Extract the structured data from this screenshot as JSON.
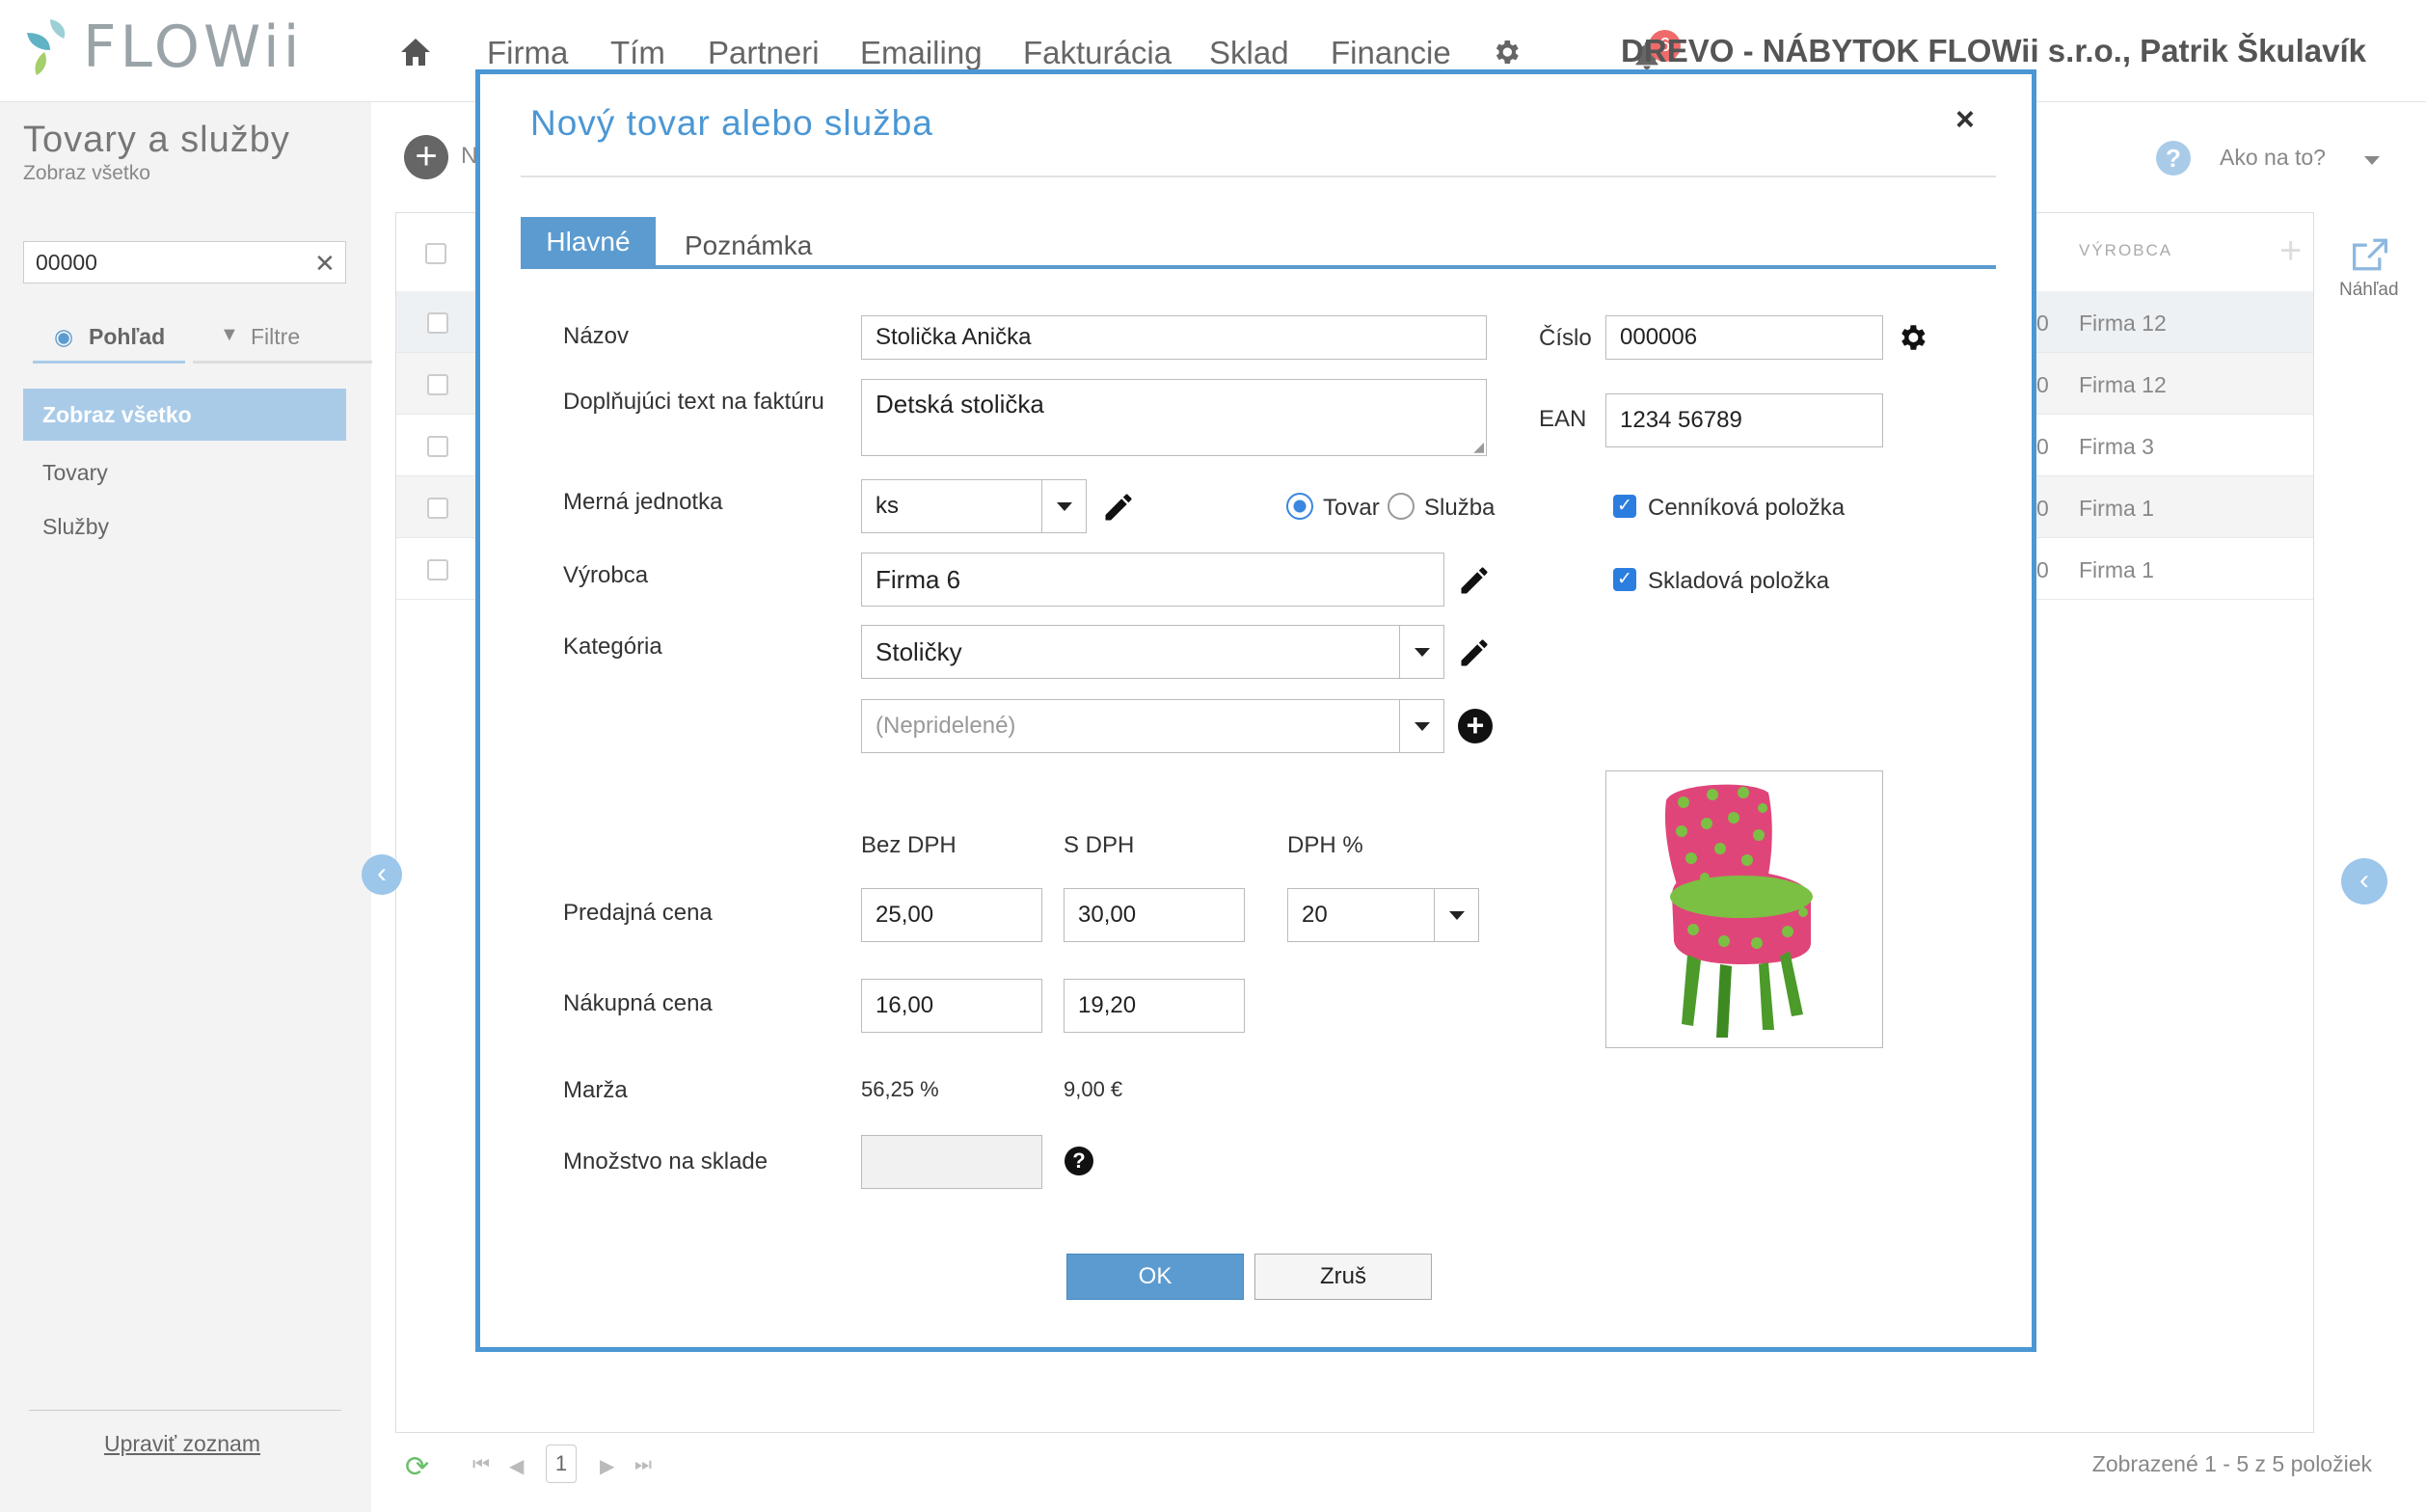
{
  "app": {
    "logo": "FLOWii",
    "nav": [
      "Firma",
      "Tím",
      "Partneri",
      "Emailing",
      "Fakturácia",
      "Sklad",
      "Financie"
    ],
    "notification_count": "6",
    "user": "DREVO - NÁBYTOK FLOWii s.r.o., Patrik Škulavík"
  },
  "page": {
    "title": "Tovary a služby",
    "subtitle": "Zobraz všetko",
    "new_label": "N",
    "help_label": "Ako na to?",
    "search_value": "00000",
    "tabs": [
      "Pohľad",
      "Filtre"
    ],
    "menu_active": "Zobraz všetko",
    "menu_items": [
      "Tovary",
      "Služby"
    ],
    "edit_list": "Upraviť zoznam",
    "column_vyrobca": "VÝROBCA",
    "preview_label": "Náhľad",
    "rows": [
      {
        "num": "0",
        "firma": "Firma 12"
      },
      {
        "num": "0",
        "firma": "Firma 12"
      },
      {
        "num": "0",
        "firma": "Firma 3"
      },
      {
        "num": "0",
        "firma": "Firma 1"
      },
      {
        "num": "0",
        "firma": "Firma 1"
      }
    ],
    "page_number": "1",
    "footer_info": "Zobrazené 1 - 5 z 5 položiek"
  },
  "modal": {
    "title": "Nový tovar alebo služba",
    "close": "×",
    "tabs": {
      "main": "Hlavné",
      "note": "Poznámka"
    },
    "labels": {
      "nazov": "Názov",
      "doplnujuci": "Doplňujúci text na faktúru",
      "merna": "Merná jednotka",
      "vyrobca": "Výrobca",
      "kategoria": "Kategória",
      "bez_dph": "Bez DPH",
      "s_dph": "S DPH",
      "dph_pct": "DPH %",
      "predajna": "Predajná cena",
      "nakupna": "Nákupná cena",
      "marza": "Marža",
      "mnozstvo": "Množstvo na sklade",
      "cislo": "Číslo",
      "ean": "EAN",
      "tovar": "Tovar",
      "sluzba": "Služba",
      "cennikova": "Cenníková položka",
      "skladova": "Skladová položka"
    },
    "values": {
      "nazov": "Stolička Anička",
      "doplnujuci": "Detská stolička",
      "merna": "ks",
      "vyrobca": "Firma 6",
      "kategoria": "Stoličky",
      "podkategoria_placeholder": "(Nepridelené)",
      "predajna_bez": "25,00",
      "predajna_s": "30,00",
      "dph": "20",
      "nakupna_bez": "16,00",
      "nakupna_s": "19,20",
      "marza_pct": "56,25 %",
      "marza_eur": "9,00 €",
      "cislo": "000006",
      "ean": "1234 56789"
    },
    "type_selected": "Tovar",
    "cennikova_checked": true,
    "skladova_checked": true,
    "buttons": {
      "ok": "OK",
      "cancel": "Zruš"
    }
  },
  "colors": {
    "accent": "#4b97d4",
    "tab_active": "#5b9bd0",
    "checkbox": "#2b7de0",
    "chair_pink": "#e0457a",
    "chair_green": "#6fb33a"
  }
}
